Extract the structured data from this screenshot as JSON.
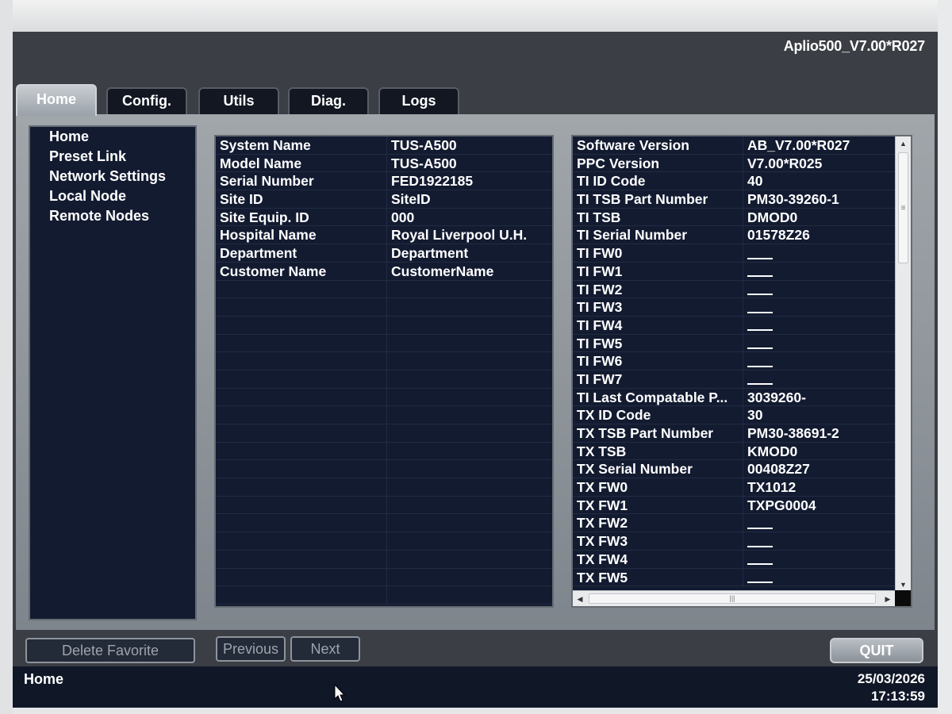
{
  "version_label": "Aplio500_V7.00*R027",
  "tabs": [
    {
      "label": "Home",
      "active": true
    },
    {
      "label": "Config.",
      "active": false
    },
    {
      "label": "Utils",
      "active": false
    },
    {
      "label": "Diag.",
      "active": false
    },
    {
      "label": "Logs",
      "active": false
    }
  ],
  "nav": {
    "items": [
      "Home",
      "Preset Link",
      "Network Settings",
      "Local Node",
      "Remote Nodes"
    ]
  },
  "system_info": {
    "rows": [
      {
        "label": "System Name",
        "value": "TUS-A500"
      },
      {
        "label": "Model Name",
        "value": "TUS-A500"
      },
      {
        "label": "Serial Number",
        "value": "FED1922185"
      },
      {
        "label": "Site ID",
        "value": "SiteID"
      },
      {
        "label": "Site Equip. ID",
        "value": "000"
      },
      {
        "label": "Hospital Name",
        "value": "Royal Liverpool U.H."
      },
      {
        "label": "Department",
        "value": "Department"
      },
      {
        "label": "Customer Name",
        "value": "CustomerName"
      }
    ],
    "empty_rows": 18
  },
  "version_info": {
    "rows": [
      {
        "label": "Software Version",
        "value": "AB_V7.00*R027"
      },
      {
        "label": "PPC Version",
        "value": "V7.00*R025"
      },
      {
        "label": "TI ID Code",
        "value": "40"
      },
      {
        "label": "TI TSB Part Number",
        "value": "PM30-39260-1"
      },
      {
        "label": "TI TSB",
        "value": "DMOD0"
      },
      {
        "label": "TI Serial Number",
        "value": "01578Z26"
      },
      {
        "label": "TI FW0",
        "value": ""
      },
      {
        "label": "TI FW1",
        "value": ""
      },
      {
        "label": "TI FW2",
        "value": ""
      },
      {
        "label": "TI FW3",
        "value": ""
      },
      {
        "label": "TI FW4",
        "value": ""
      },
      {
        "label": "TI FW5",
        "value": ""
      },
      {
        "label": "TI FW6",
        "value": ""
      },
      {
        "label": "TI FW7",
        "value": ""
      },
      {
        "label": "TI Last Compatable P...",
        "value": "3039260-"
      },
      {
        "label": "TX ID Code",
        "value": "30"
      },
      {
        "label": "TX TSB Part Number",
        "value": "PM30-38691-2"
      },
      {
        "label": "TX TSB",
        "value": "KMOD0"
      },
      {
        "label": "TX Serial Number",
        "value": "00408Z27"
      },
      {
        "label": "TX FW0",
        "value": "TX1012"
      },
      {
        "label": "TX FW1",
        "value": "TXPG0004"
      },
      {
        "label": "TX FW2",
        "value": ""
      },
      {
        "label": "TX FW3",
        "value": ""
      },
      {
        "label": "TX FW4",
        "value": ""
      },
      {
        "label": "TX FW5",
        "value": ""
      }
    ]
  },
  "buttons": {
    "delete_favorite": "Delete Favorite",
    "previous": "Previous",
    "next": "Next",
    "quit": "QUIT"
  },
  "status": {
    "page": "Home",
    "date": "25/03/2026",
    "time": "17:13:59"
  },
  "colors": {
    "panel_bg": "#131b31",
    "frame_bg": "#3b3e44",
    "active_tab": "#aeb3b9"
  },
  "icons": [
    "scroll-up-icon",
    "scroll-down-icon",
    "scroll-left-icon",
    "scroll-right-icon",
    "mouse-pointer-icon"
  ]
}
